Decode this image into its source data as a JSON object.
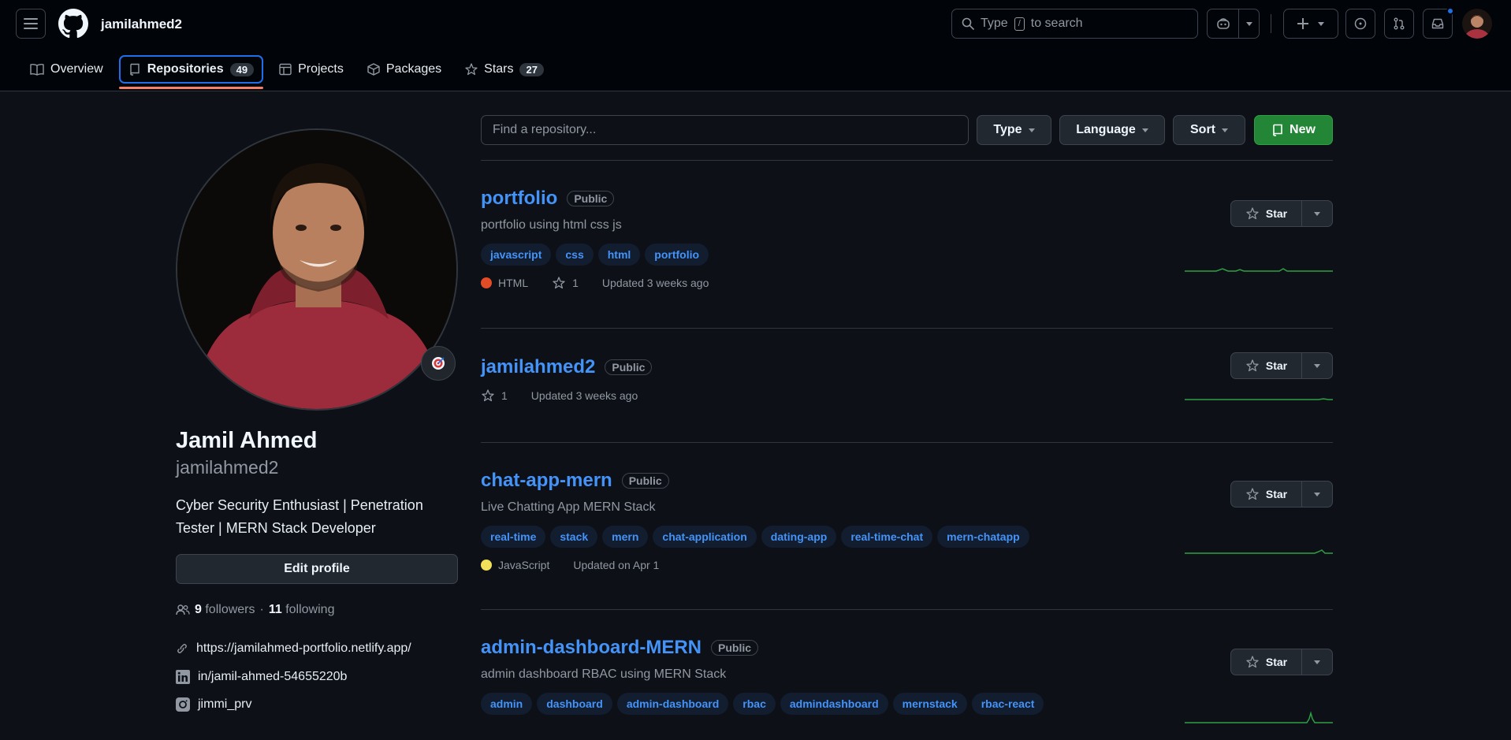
{
  "header": {
    "username": "jamilahmed2",
    "search_placeholder_pre": "Type",
    "search_key": "/",
    "search_placeholder_post": "to search"
  },
  "nav": {
    "tabs": [
      {
        "label": "Overview",
        "icon": "book-icon"
      },
      {
        "label": "Repositories",
        "count": "49",
        "icon": "repo-icon",
        "selected": true
      },
      {
        "label": "Projects",
        "icon": "table-icon"
      },
      {
        "label": "Packages",
        "icon": "package-icon"
      },
      {
        "label": "Stars",
        "count": "27",
        "icon": "star-icon"
      }
    ]
  },
  "profile": {
    "name": "Jamil Ahmed",
    "login": "jamilahmed2",
    "bio": "Cyber Security Enthusiast | Penetration Tester | MERN Stack Developer",
    "edit_label": "Edit profile",
    "followers": "9",
    "followers_label": "followers",
    "dot": "·",
    "following": "11",
    "following_label": "following",
    "website": "https://jamilahmed-portfolio.netlify.app/",
    "linkedin": "in/jamil-ahmed-54655220b",
    "instagram": "jimmi_prv"
  },
  "toolbar": {
    "find_placeholder": "Find a repository...",
    "type_label": "Type",
    "language_label": "Language",
    "sort_label": "Sort",
    "new_label": "New"
  },
  "repos": [
    {
      "name": "portfolio",
      "visibility": "Public",
      "description": "portfolio using html css js",
      "topics": [
        "javascript",
        "css",
        "html",
        "portfolio"
      ],
      "language": "HTML",
      "language_color": "#e34c26",
      "stars": "1",
      "updated": "Updated 3 weeks ago",
      "star_label": "Star"
    },
    {
      "name": "jamilahmed2",
      "visibility": "Public",
      "stars": "1",
      "updated": "Updated 3 weeks ago",
      "star_label": "Star"
    },
    {
      "name": "chat-app-mern",
      "visibility": "Public",
      "description": "Live Chatting App MERN Stack",
      "topics": [
        "real-time",
        "stack",
        "mern",
        "chat-application",
        "dating-app",
        "real-time-chat",
        "mern-chatapp"
      ],
      "language": "JavaScript",
      "language_color": "#f1e05a",
      "updated": "Updated on Apr 1",
      "star_label": "Star"
    },
    {
      "name": "admin-dashboard-MERN",
      "visibility": "Public",
      "description": "admin dashboard RBAC using MERN Stack",
      "topics": [
        "admin",
        "dashboard",
        "admin-dashboard",
        "rbac",
        "admindashboard",
        "mernstack",
        "rbac-react"
      ],
      "star_label": "Star"
    }
  ],
  "colors": {
    "accent_link": "#4493f8",
    "selected_tab_border": "#1f6feb",
    "underline": "#f78166",
    "new_button": "#238636",
    "sparkline": "#2ea043"
  }
}
